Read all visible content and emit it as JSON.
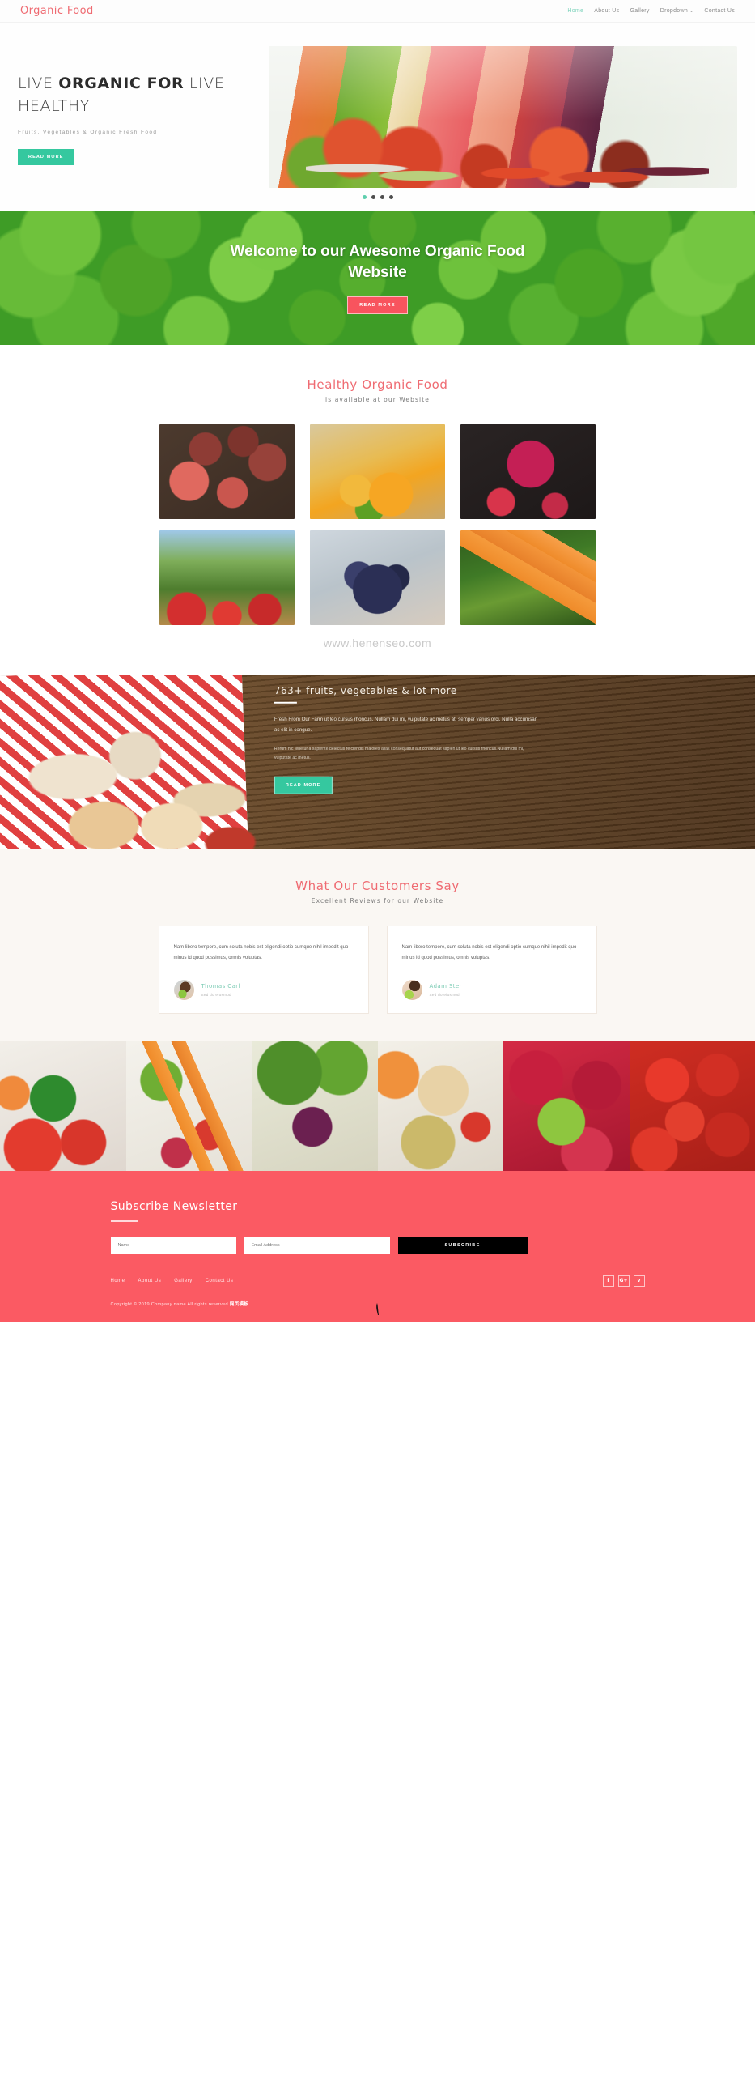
{
  "header": {
    "brand": "Organic Food",
    "nav": [
      {
        "label": "Home",
        "active": true
      },
      {
        "label": "About Us",
        "active": false
      },
      {
        "label": "Gallery",
        "active": false
      },
      {
        "label": "Dropdown",
        "active": false,
        "caret": "⌄"
      },
      {
        "label": "Contact Us",
        "active": false
      }
    ]
  },
  "hero": {
    "title_part1": "LIVE ",
    "title_bold": "ORGANIC FOR",
    "title_part2": " LIVE HEALTHY",
    "subtitle": "Fruits, Vegetables & Organic Fresh Food",
    "button": "READ MORE",
    "slide_count": 4,
    "active_slide": 1,
    "accent_teal": "#35c89f"
  },
  "welcome": {
    "title": "Welcome to our Awesome Organic Food Website",
    "button": "READ MORE",
    "accent_pink": "#f8545e"
  },
  "gallery": {
    "title": "Healthy Organic Food",
    "subtitle": "is available at our Website",
    "watermark": "www.henenseo.com",
    "tiles": [
      {
        "name": "plums-on-wood"
      },
      {
        "name": "orange-juice"
      },
      {
        "name": "berry-smoothie-jar"
      },
      {
        "name": "apple-orchard-basket"
      },
      {
        "name": "hands-holding-blueberries"
      },
      {
        "name": "fresh-carrots"
      }
    ]
  },
  "wood_band": {
    "title": "763+ fruits, vegetables & lot more",
    "paragraph1": "Fresh From Our Farm ut leo cursus rhoncus. Nullam dui mi, vulputate ac metus at, semper varius orci. Nulla accumsan ac elit in congue.",
    "paragraph2": "Rerum hic tenetur a sapiente delectus reiciendis maiores alias consequatur aut consequat sapien ut leo cursus rhoncus.Nullam dui mi, vulputate ac metus.",
    "button": "READ MORE"
  },
  "testimonials": {
    "title": "What Our Customers Say",
    "subtitle": "Excellent Reviews for our Website",
    "cards": [
      {
        "quote": "Nam libero tempore, cum soluta nobis est eligendi optio cumque nihil impedit quo minus id quod possimus, omnis voluptas.",
        "name": "Thomas Carl",
        "role": "Sed do eiusmod"
      },
      {
        "quote": "Nam libero tempore, cum soluta nobis est eligendi optio cumque nihil impedit quo minus id quod possimus, omnis voluptas.",
        "name": "Adam Ster",
        "role": "Sed do eiusmod"
      }
    ]
  },
  "strip": {
    "cells": [
      {
        "name": "peppers-and-tomatoes"
      },
      {
        "name": "carrots-and-herbs"
      },
      {
        "name": "red-onion-and-peppercorns"
      },
      {
        "name": "squash-and-potatoes"
      },
      {
        "name": "raspberries-with-leaf"
      },
      {
        "name": "cherry-tomatoes"
      }
    ]
  },
  "newsletter": {
    "title": "Subscribe Newsletter",
    "name_placeholder": "Name",
    "email_placeholder": "Email Address",
    "submit_label": "SUBSCRIBE",
    "background": "#fb5a63"
  },
  "footer": {
    "nav": [
      "Home",
      "About Us",
      "Gallery",
      "Contact Us"
    ],
    "socials": [
      {
        "name": "facebook-icon",
        "glyph": "f"
      },
      {
        "name": "google-plus-icon",
        "glyph": "G+"
      },
      {
        "name": "twitter-icon",
        "glyph": "ᴠ"
      }
    ],
    "copyright_text": "Copyright © 2019.Company name All rights reserved.",
    "copyright_cn": "网页模板"
  }
}
